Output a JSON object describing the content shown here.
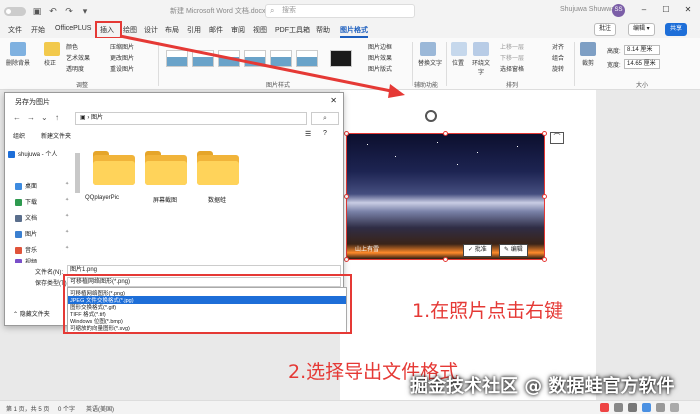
{
  "titlebar": {
    "doc_title": "新建 Microsoft Word 文档.docx",
    "search_placeholder": "搜索",
    "user_name": "Shujuwa Shuwwa",
    "avatar_initials": "SS"
  },
  "menu": {
    "tabs": [
      "文件",
      "开始",
      "OfficePLUS",
      "插入",
      "绘图",
      "设计",
      "布局",
      "引用",
      "邮件",
      "审阅",
      "视图",
      "PDF工具箱",
      "帮助",
      "图片格式"
    ],
    "active_tab": "图片格式",
    "comment_btn": "批注",
    "edit_btn": "编辑",
    "share_btn": "共享"
  },
  "ribbon": {
    "remove_bg": "删除背景",
    "correct": "校正",
    "color": "颜色",
    "art_effects": "艺术效果",
    "transparency": "透明度",
    "compress": "压缩图片",
    "change_pic": "更改图片",
    "reset_pic": "重设图片",
    "group_adjust": "调整",
    "group_styles": "图片样式",
    "border": "图片边框",
    "effects": "图片效果",
    "layout": "图片版式",
    "alt_text": "替换文字",
    "group_a11y": "辅助功能",
    "position": "位置",
    "wrap": "环绕文字",
    "bring_forward": "上移一层",
    "send_backward": "下移一层",
    "selection_pane": "选择窗格",
    "align": "对齐",
    "group": "组合",
    "rotate": "旋转",
    "group_arrange": "排列",
    "crop": "裁剪",
    "height_label": "高度:",
    "height_value": "8.14 厘米",
    "width_label": "宽度:",
    "width_value": "14.65 厘米",
    "group_size": "大小"
  },
  "dialog": {
    "title": "另存为图片",
    "path": "图片",
    "organize": "组织",
    "new_folder": "新建文件夹",
    "sidebar": [
      {
        "label": "shujuwa - 个人",
        "icon": "cloud-icon",
        "color": "#1d6ed8"
      },
      {
        "label": "桌面",
        "icon": "desktop-icon",
        "color": "#3d8be0"
      },
      {
        "label": "下载",
        "icon": "download-icon",
        "color": "#2e9a4f"
      },
      {
        "label": "文档",
        "icon": "document-icon",
        "color": "#5a6e8c"
      },
      {
        "label": "图片",
        "icon": "picture-icon",
        "color": "#3a7fd0"
      },
      {
        "label": "音乐",
        "icon": "music-icon",
        "color": "#e0533a"
      },
      {
        "label": "视频",
        "icon": "video-icon",
        "color": "#7a4fc9"
      }
    ],
    "folders": [
      "QQplayerPic",
      "屏幕截图",
      "数据蛙"
    ],
    "filename_label": "文件名(N):",
    "filename_value": "图片1.png",
    "filetype_label": "保存类型(T):",
    "filetype_value": "可移植网络图形(*.png)",
    "filetype_options": [
      "可移植网络图形(*.png)",
      "JPEG 文件交换格式(*.jpg)",
      "图形交换格式(*.gif)",
      "TIFF 格式(*.tif)",
      "Windows 位图(*.bmp)",
      "可缩放的向量图形(*.svg)"
    ],
    "selected_option": 1,
    "hide_folders": "隐藏文件夹"
  },
  "image": {
    "caption": "山上有雪",
    "comment_btn": "批准",
    "edit_btn": "编辑"
  },
  "annotations": {
    "step1": "1.在照片点击右键",
    "step2": "2.选择导出文件格式",
    "watermark": "掘金技术社区 @ 数据蛙官方软件",
    "accent": "#e53935"
  },
  "status": {
    "page": "第 1 页，共 5 页",
    "words": "0 个字",
    "lang": "英语(美国)"
  }
}
